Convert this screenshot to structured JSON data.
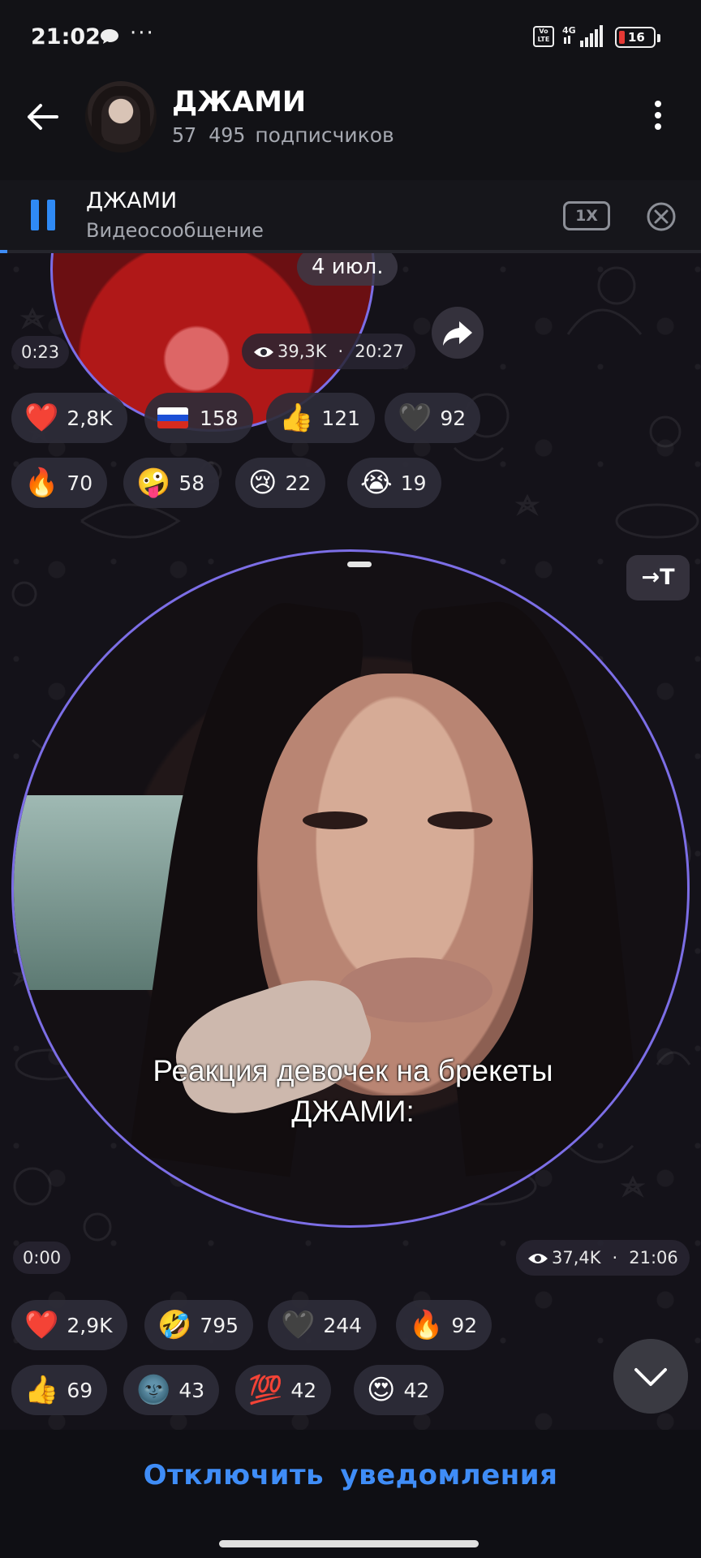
{
  "status_bar": {
    "time": "21:02",
    "dots": "···",
    "volte": "Vo LTE",
    "network": "4G",
    "battery_level": "16",
    "battery_color": "#e53935"
  },
  "header": {
    "title": "ДЖАМИ",
    "subscribers_count": "57 495",
    "subscribers_label": "подписчиков"
  },
  "player": {
    "title": "ДЖАМИ",
    "subtitle": "Видеосообщение",
    "speed": "1X",
    "accent": "#2f8af5"
  },
  "messages": [
    {
      "date": "4 июл.",
      "duration": "0:23",
      "views": "39,3K",
      "time": "20:27",
      "reactions": [
        {
          "emoji": "❤️",
          "count": "2,8K"
        },
        {
          "emoji": "flag-ru",
          "count": "158"
        },
        {
          "emoji": "👍",
          "count": "121"
        },
        {
          "emoji": "🖤",
          "count": "92"
        },
        {
          "emoji": "🔥",
          "count": "70"
        },
        {
          "emoji": "🤪",
          "count": "58"
        },
        {
          "emoji": "😢",
          "count": "22"
        },
        {
          "emoji": "😭",
          "count": "19"
        }
      ]
    },
    {
      "caption_line1": "Реакция девочек на брекеты",
      "caption_line2": "ДЖАМИ:",
      "duration": "0:00",
      "views": "37,4K",
      "time": "21:06",
      "translate": "→T",
      "reactions": [
        {
          "emoji": "❤️",
          "count": "2,9K"
        },
        {
          "emoji": "🤣",
          "count": "795"
        },
        {
          "emoji": "🖤",
          "count": "244"
        },
        {
          "emoji": "🔥",
          "count": "92"
        },
        {
          "emoji": "👍",
          "count": "69"
        },
        {
          "emoji": "🌚",
          "count": "43"
        },
        {
          "emoji": "💯",
          "count": "42"
        },
        {
          "emoji": "😍",
          "count": "42"
        }
      ]
    }
  ],
  "bottom": {
    "mute_label": "Отключить уведомления"
  },
  "colors": {
    "link": "#3f8df7",
    "video_ring": "#7c6ee6",
    "background": "#141219"
  }
}
